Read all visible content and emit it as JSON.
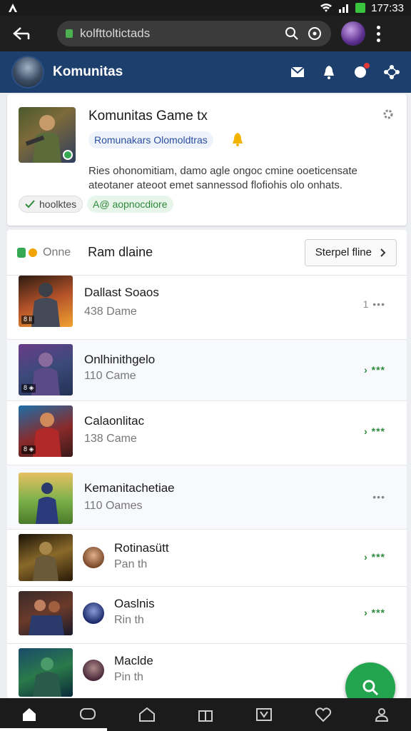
{
  "status": {
    "time": "177:33"
  },
  "browser": {
    "url": "kolfttoltictads"
  },
  "header": {
    "title": "Komunitas"
  },
  "community": {
    "title": "Komunitas Game tx",
    "subtitle": "Romunakars Olomoldtras",
    "description": "Ries ohonomitiam, damo agle ongoc cmine ooeticensate ateotaner ateoot emet sannessod flofiohis olo onhats.",
    "chip_left": "hoolktes",
    "chip_right": "A@ aopnocdiore"
  },
  "list": {
    "online_label": "Onne",
    "title": "Ram dlaine",
    "sort_label": "Sterpel fline",
    "rows": [
      {
        "title": "Dallast Soaos",
        "subtitle": "438 Dame",
        "action": "1 •••",
        "tag": "8 ll"
      },
      {
        "title": "Onlhinithgelo",
        "subtitle": "110 Came",
        "action": "› ***",
        "tag": "8 ◈"
      },
      {
        "title": "Calaonlitac",
        "subtitle": "138 Came",
        "action": "› ***",
        "tag": "8 ◈"
      },
      {
        "title": "Kemanitachetiae",
        "subtitle": "110 Oames",
        "action": "•••"
      },
      {
        "title": "Rotinasütt",
        "subtitle": "Pan th",
        "action": "› ***"
      },
      {
        "title": "Oaslnis",
        "subtitle": "Rin th",
        "action": "› ***"
      },
      {
        "title": "Maclde",
        "subtitle": "Pin th"
      }
    ]
  },
  "colors": {
    "accent": "#1d3f6e",
    "green": "#23a550"
  }
}
